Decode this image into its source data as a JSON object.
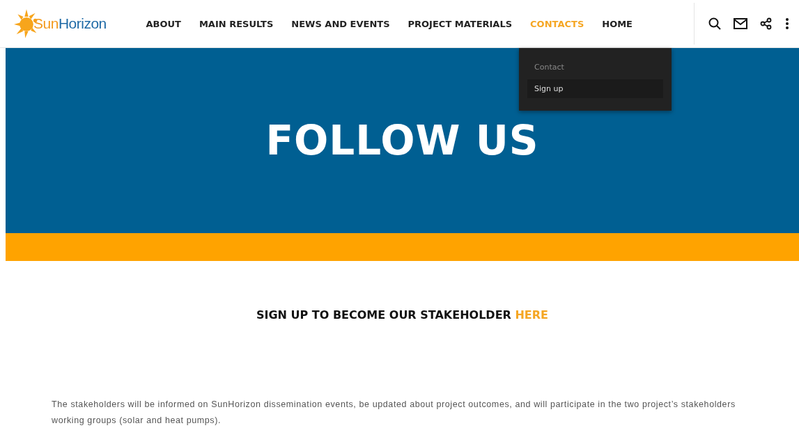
{
  "logo": {
    "parts": [
      "Sun",
      "Horizon"
    ]
  },
  "nav": [
    {
      "label": "ABOUT",
      "selected": false
    },
    {
      "label": "MAIN RESULTS",
      "selected": false
    },
    {
      "label": "NEWS AND EVENTS",
      "selected": false
    },
    {
      "label": "PROJECT MATERIALS",
      "selected": false
    },
    {
      "label": "CONTACTS",
      "selected": true
    },
    {
      "label": "HOME",
      "selected": false
    }
  ],
  "dropdown": [
    {
      "label": "Contact",
      "selected": false
    },
    {
      "label": "Sign up",
      "selected": true
    }
  ],
  "banner": {
    "title": "FOLLOW US"
  },
  "signup": {
    "text": "SIGN UP TO BECOME OUR STAKEHOLDER",
    "link": "HERE"
  },
  "paragraph": "The stakeholders will be informed on SunHorizon dissemination events, be updated about project outcomes, and will participate in the two project’s stakeholders working groups (solar and heat pumps)."
}
